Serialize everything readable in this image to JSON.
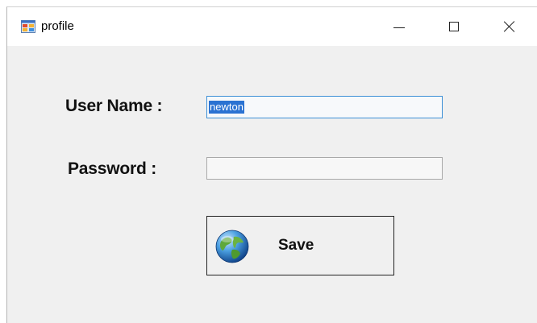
{
  "window": {
    "title": "profile",
    "icon": "form-app-icon",
    "controls": {
      "minimize_icon": "minimize-icon",
      "maximize_icon": "maximize-icon",
      "close_icon": "close-icon"
    }
  },
  "form": {
    "username_label": "User Name :",
    "username_value": "newton",
    "password_label": "Password :",
    "password_value": "",
    "save_label": "Save",
    "save_icon": "globe-icon"
  },
  "colors": {
    "window_bg": "#f0f0f0",
    "titlebar_bg": "#ffffff",
    "selection": "#2a72d2",
    "focus_border": "#3c8fd6"
  }
}
